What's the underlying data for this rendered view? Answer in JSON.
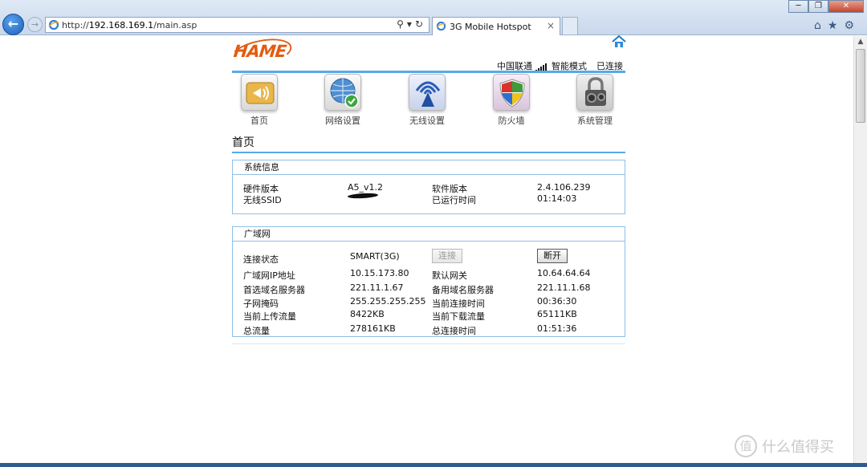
{
  "browser": {
    "url_prefix": "http://",
    "url_host": "192.168.169.1",
    "url_path": "/main.asp",
    "tab_title": "3G Mobile Hotspot",
    "tab_close": "×"
  },
  "header": {
    "logo": "HAME",
    "carrier": "中国联通",
    "mode": "智能模式",
    "connection": "已连接"
  },
  "menu": {
    "items": [
      {
        "label": "首页",
        "icon": "home-sound-icon"
      },
      {
        "label": "网络设置",
        "icon": "globe-check-icon"
      },
      {
        "label": "无线设置",
        "icon": "wireless-tower-icon"
      },
      {
        "label": "防火墙",
        "icon": "shield-icon"
      },
      {
        "label": "系统管理",
        "icon": "gears-lock-icon"
      }
    ]
  },
  "page_title": "首页",
  "system_info": {
    "title": "系统信息",
    "rows": [
      {
        "l1": "硬件版本",
        "v1": "A5_v1.2",
        "l2": "软件版本",
        "v2": "2.4.106.239"
      },
      {
        "l1": "无线SSID",
        "v1": "",
        "l2": "已运行时间",
        "v2": "01:14:03"
      }
    ]
  },
  "wan": {
    "title": "广域网",
    "status_label": "连接状态",
    "status_value": "SMART(3G)",
    "connect_button": "连接",
    "disconnect_button": "断开",
    "rows": [
      {
        "l1": "广域网IP地址",
        "v1": "10.15.173.80",
        "l2": "默认网关",
        "v2": "10.64.64.64"
      },
      {
        "l1": "首选域名服务器",
        "v1": "221.11.1.67",
        "l2": "备用域名服务器",
        "v2": "221.11.1.68"
      },
      {
        "l1": "子网掩码",
        "v1": "255.255.255.255",
        "l2": "当前连接时间",
        "v2": "00:36:30"
      },
      {
        "l1": "当前上传流量",
        "v1": "8422KB",
        "l2": "当前下载流量",
        "v2": "65111KB"
      },
      {
        "l1": "总流量",
        "v1": "278161KB",
        "l2": "总连接时间",
        "v2": "01:51:36"
      }
    ]
  },
  "watermark": {
    "glyph": "值",
    "text": "什么值得买"
  }
}
